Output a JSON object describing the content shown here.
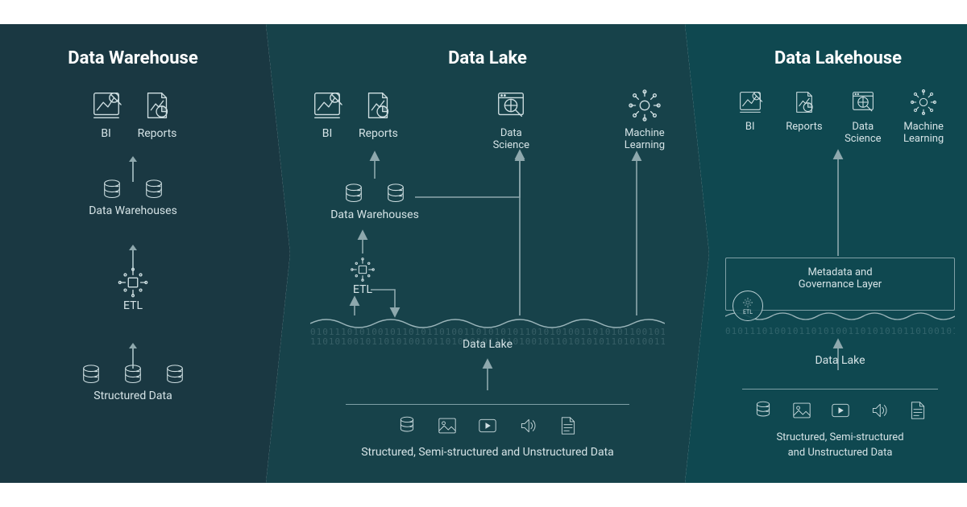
{
  "panels": {
    "warehouse": {
      "title": "Data Warehouse",
      "bi": "BI",
      "reports": "Reports",
      "dw": "Data Warehouses",
      "etl": "ETL",
      "src": "Structured Data"
    },
    "lake": {
      "title": "Data Lake",
      "bi": "BI",
      "reports": "Reports",
      "ds": "Data\nScience",
      "ml": "Machine\nLearning",
      "dw": "Data Warehouses",
      "etl": "ETL",
      "lake_label": "Data Lake",
      "src": "Structured, Semi-structured and Unstructured Data"
    },
    "lakehouse": {
      "title": "Data Lakehouse",
      "bi": "BI",
      "reports": "Reports",
      "ds": "Data\nScience",
      "ml": "Machine\nLearning",
      "meta": "Metadata and\nGovernance Layer",
      "etl": "ETL",
      "lake_label": "Data Lake",
      "src": "Structured, Semi-structured\nand Unstructured Data"
    }
  },
  "colors": {
    "panel1": "#1a3842",
    "panel2": "#17424a",
    "panel3": "#0f4850"
  }
}
